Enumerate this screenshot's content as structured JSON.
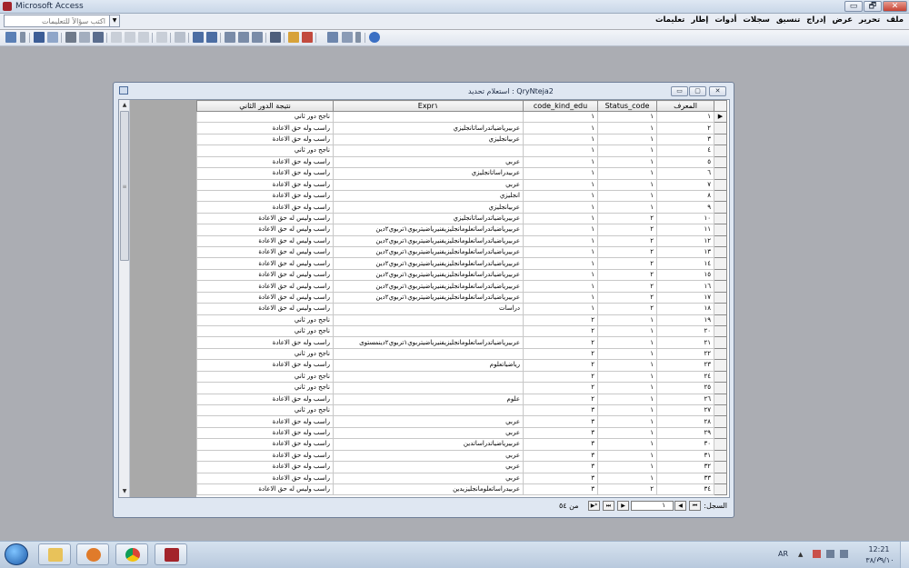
{
  "app": {
    "title": "Microsoft Access",
    "help_placeholder": "اكتب سؤالاً للتعليمات",
    "window_buttons": {
      "minimize": "▭",
      "maximize": "🗗",
      "close": "✕"
    }
  },
  "menu": {
    "items": [
      "ملف",
      "تحرير",
      "عرض",
      "إدراج",
      "تنسيق",
      "سجلات",
      "أدوات",
      "إطار",
      "تعليمات"
    ]
  },
  "toolbar": {
    "icons": [
      "view-icon",
      "save-icon",
      "search-file-icon",
      "print-icon",
      "print-preview-icon",
      "spell-check-icon",
      "cut-icon",
      "copy-icon",
      "paste-icon",
      "undo-icon",
      "hyperlink-icon",
      "sort-ascending-icon",
      "sort-descending-icon",
      "filter-selection-icon",
      "filter-form-icon",
      "apply-filter-icon",
      "find-icon",
      "new-record-icon",
      "delete-record-icon",
      "database-window-icon",
      "new-object-icon",
      "help-icon"
    ]
  },
  "query_window": {
    "title": "QryNteja2 : استعلام تحديد",
    "buttons": {
      "minimize": "▭",
      "maximize": "▢",
      "close": "✕"
    }
  },
  "datasheet": {
    "columns": [
      "المعرف",
      "Status_code",
      "code_kind_edu",
      "Expr١",
      "نتيجة الدور الثاني"
    ],
    "rows": [
      [
        "١",
        "١",
        "١",
        "",
        "ناجح دور ثاني"
      ],
      [
        "٢",
        "١",
        "١",
        "عربيرياضياتدراساتانجليزي",
        "راسب وله حق الاعادة"
      ],
      [
        "٣",
        "١",
        "١",
        "عربيانجليزي",
        "راسب وله حق الاعادة"
      ],
      [
        "٤",
        "١",
        "١",
        "",
        "ناجح دور ثاني"
      ],
      [
        "٥",
        "١",
        "١",
        "عربي",
        "راسب وله حق الاعادة"
      ],
      [
        "٦",
        "١",
        "١",
        "عربيدراساتانجليزي",
        "راسب وله حق الاعادة"
      ],
      [
        "٧",
        "١",
        "١",
        "عربي",
        "راسب وله حق الاعادة"
      ],
      [
        "٨",
        "١",
        "١",
        "انجليزي",
        "راسب وله حق الاعادة"
      ],
      [
        "٩",
        "١",
        "١",
        "عربيانجليزي",
        "راسب وله حق الاعادة"
      ],
      [
        "١٠",
        "٢",
        "١",
        "عربيرياضياتدراساتانجليزي",
        "راسب وليس له حق الاعادة"
      ],
      [
        "١١",
        "٢",
        "١",
        "عربيرياضياتدراساتعلومانجليزيفنيرياضيتربوي١تربوي٢دين",
        "راسب وليس له حق الاعادة"
      ],
      [
        "١٢",
        "٢",
        "١",
        "عربيرياضياتدراساتعلومانجليزيفنيرياضيتربوي١تربوي٢دين",
        "راسب وليس له حق الاعادة"
      ],
      [
        "١٣",
        "٢",
        "١",
        "عربيرياضياتدراساتعلومانجليزيفنيرياضيتربوي١تربوي٢دين",
        "راسب وليس له حق الاعادة"
      ],
      [
        "١٤",
        "٢",
        "١",
        "عربيرياضياتدراساتعلومانجليزيفنيرياضيتربوي١تربوي٢دين",
        "راسب وليس له حق الاعادة"
      ],
      [
        "١٥",
        "٢",
        "١",
        "عربيرياضياتدراساتعلومانجليزيفنيرياضيتربوي١تربوي٢دين",
        "راسب وليس له حق الاعادة"
      ],
      [
        "١٦",
        "٢",
        "١",
        "عربيرياضياتدراساتعلومانجليزيفنيرياضيتربوي١تربوي٢دين",
        "راسب وليس له حق الاعادة"
      ],
      [
        "١٧",
        "٢",
        "١",
        "عربيرياضياتدراساتعلومانجليزيفنيرياضيتربوي١تربوي٢دين",
        "راسب وليس له حق الاعادة"
      ],
      [
        "١٨",
        "٢",
        "١",
        "دراسات",
        "راسب وليس له حق الاعادة"
      ],
      [
        "١٩",
        "١",
        "٢",
        "",
        "ناجح دور ثاني"
      ],
      [
        "٢٠",
        "١",
        "٢",
        "",
        "ناجح دور ثاني"
      ],
      [
        "٢١",
        "١",
        "٢",
        "عربيرياضياتدراساتعلومانجليزيفنيرياضيتربوي١تربوي٢دينمستوى",
        "راسب وله حق الاعادة"
      ],
      [
        "٢٢",
        "١",
        "٢",
        "",
        "ناجح دور ثاني"
      ],
      [
        "٢٣",
        "١",
        "٢",
        "رياضياتعلوم",
        "راسب وله حق الاعادة"
      ],
      [
        "٢٤",
        "١",
        "٢",
        "",
        "ناجح دور ثاني"
      ],
      [
        "٢٥",
        "١",
        "٢",
        "",
        "ناجح دور ثاني"
      ],
      [
        "٢٦",
        "١",
        "٢",
        "علوم",
        "راسب وله حق الاعادة"
      ],
      [
        "٢٧",
        "١",
        "٣",
        "",
        "ناجح دور ثاني"
      ],
      [
        "٢٨",
        "١",
        "٣",
        "عربي",
        "راسب وله حق الاعادة"
      ],
      [
        "٢٩",
        "١",
        "٣",
        "عربي",
        "راسب وله حق الاعادة"
      ],
      [
        "٣٠",
        "١",
        "٣",
        "عربيرياضياتدراساتدين",
        "راسب وله حق الاعادة"
      ],
      [
        "٣١",
        "١",
        "٣",
        "عربي",
        "راسب وله حق الاعادة"
      ],
      [
        "٣٢",
        "١",
        "٣",
        "عربي",
        "راسب وله حق الاعادة"
      ],
      [
        "٣٣",
        "١",
        "٣",
        "عربي",
        "راسب وله حق الاعادة"
      ],
      [
        "٣٤",
        "٢",
        "٣",
        "عربيدراساتعلومانجليزيدين",
        "راسب وليس له حق الاعادة"
      ]
    ]
  },
  "navigation": {
    "label": "السجل:",
    "current": "١",
    "total": "من ٥٤",
    "buttons": {
      "first": "⏮",
      "prev": "◀",
      "next": "▶",
      "last": "⏭",
      "new": "▶*"
    }
  },
  "taskbar": {
    "language": "AR",
    "time": "12:21 م",
    "date": "٣٨/٠٩/١٠"
  }
}
